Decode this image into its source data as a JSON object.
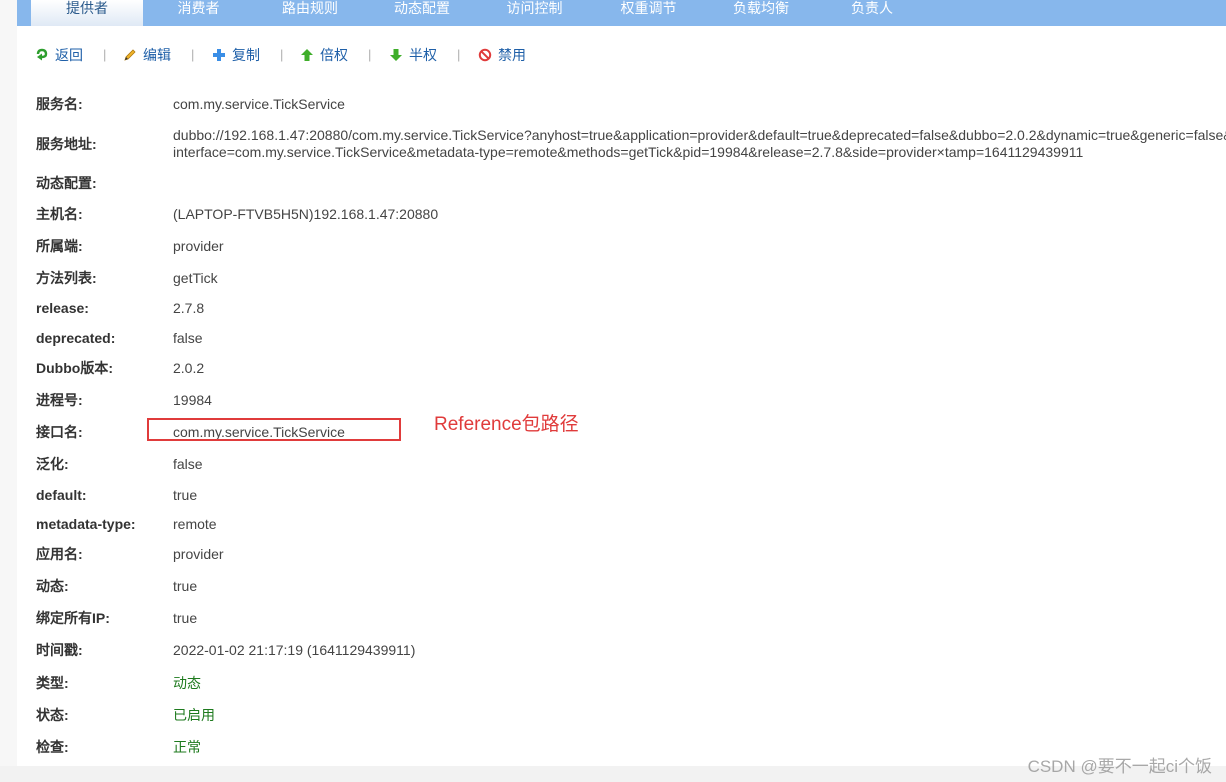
{
  "tabs": [
    {
      "label": "提供者",
      "active": true
    },
    {
      "label": "消费者"
    },
    {
      "label": "路由规则"
    },
    {
      "label": "动态配置"
    },
    {
      "label": "访问控制"
    },
    {
      "label": "权重调节"
    },
    {
      "label": "负载均衡"
    },
    {
      "label": "负责人"
    }
  ],
  "toolbar": {
    "back": "返回",
    "edit": "编辑",
    "copy": "复制",
    "double_weight": "倍权",
    "half_weight": "半权",
    "disable": "禁用",
    "separator": "|"
  },
  "details": {
    "service_name": {
      "label": "服务名:",
      "value": "com.my.service.TickService"
    },
    "service_url": {
      "label": "服务地址:",
      "value": "dubbo://192.168.1.47:20880/com.my.service.TickService?anyhost=true&application=provider&default=true&deprecated=false&dubbo=2.0.2&dynamic=true&generic=false&interface=com.my.service.TickService&metadata-type=remote&methods=getTick&pid=19984&release=2.7.8&side=provider×tamp=1641129439911"
    },
    "dynamic_config": {
      "label": "动态配置:",
      "value": ""
    },
    "host": {
      "label": "主机名:",
      "value": "(LAPTOP-FTVB5H5N)192.168.1.47:20880"
    },
    "side": {
      "label": "所属端:",
      "value": "provider"
    },
    "methods": {
      "label": "方法列表:",
      "value": "getTick"
    },
    "release": {
      "label": "release:",
      "value": "2.7.8"
    },
    "deprecated": {
      "label": "deprecated:",
      "value": "false"
    },
    "dubbo_version": {
      "label": "Dubbo版本:",
      "value": "2.0.2"
    },
    "pid": {
      "label": "进程号:",
      "value": "19984"
    },
    "interface": {
      "label": "接口名:",
      "value": "com.my.service.TickService"
    },
    "generic": {
      "label": "泛化:",
      "value": "false"
    },
    "default": {
      "label": "default:",
      "value": "true"
    },
    "metadata_type": {
      "label": "metadata-type:",
      "value": "remote"
    },
    "application": {
      "label": "应用名:",
      "value": "provider"
    },
    "dynamic": {
      "label": "动态:",
      "value": "true"
    },
    "bind_all_ip": {
      "label": "绑定所有IP:",
      "value": "true"
    },
    "timestamp": {
      "label": "时间戳:",
      "value": "2022-01-02 21:17:19 (1641129439911)"
    },
    "type": {
      "label": "类型:",
      "value": "动态"
    },
    "status": {
      "label": "状态:",
      "value": "已启用"
    },
    "check": {
      "label": "检查:",
      "value": "正常"
    }
  },
  "annotation": "Reference包路径",
  "watermark": "CSDN @要不一起ci个饭",
  "colors": {
    "tabbar": "#87b7ec",
    "link": "#1e5fa8",
    "annotation": "#e03b3b",
    "status_green": "#1e7a1e"
  }
}
